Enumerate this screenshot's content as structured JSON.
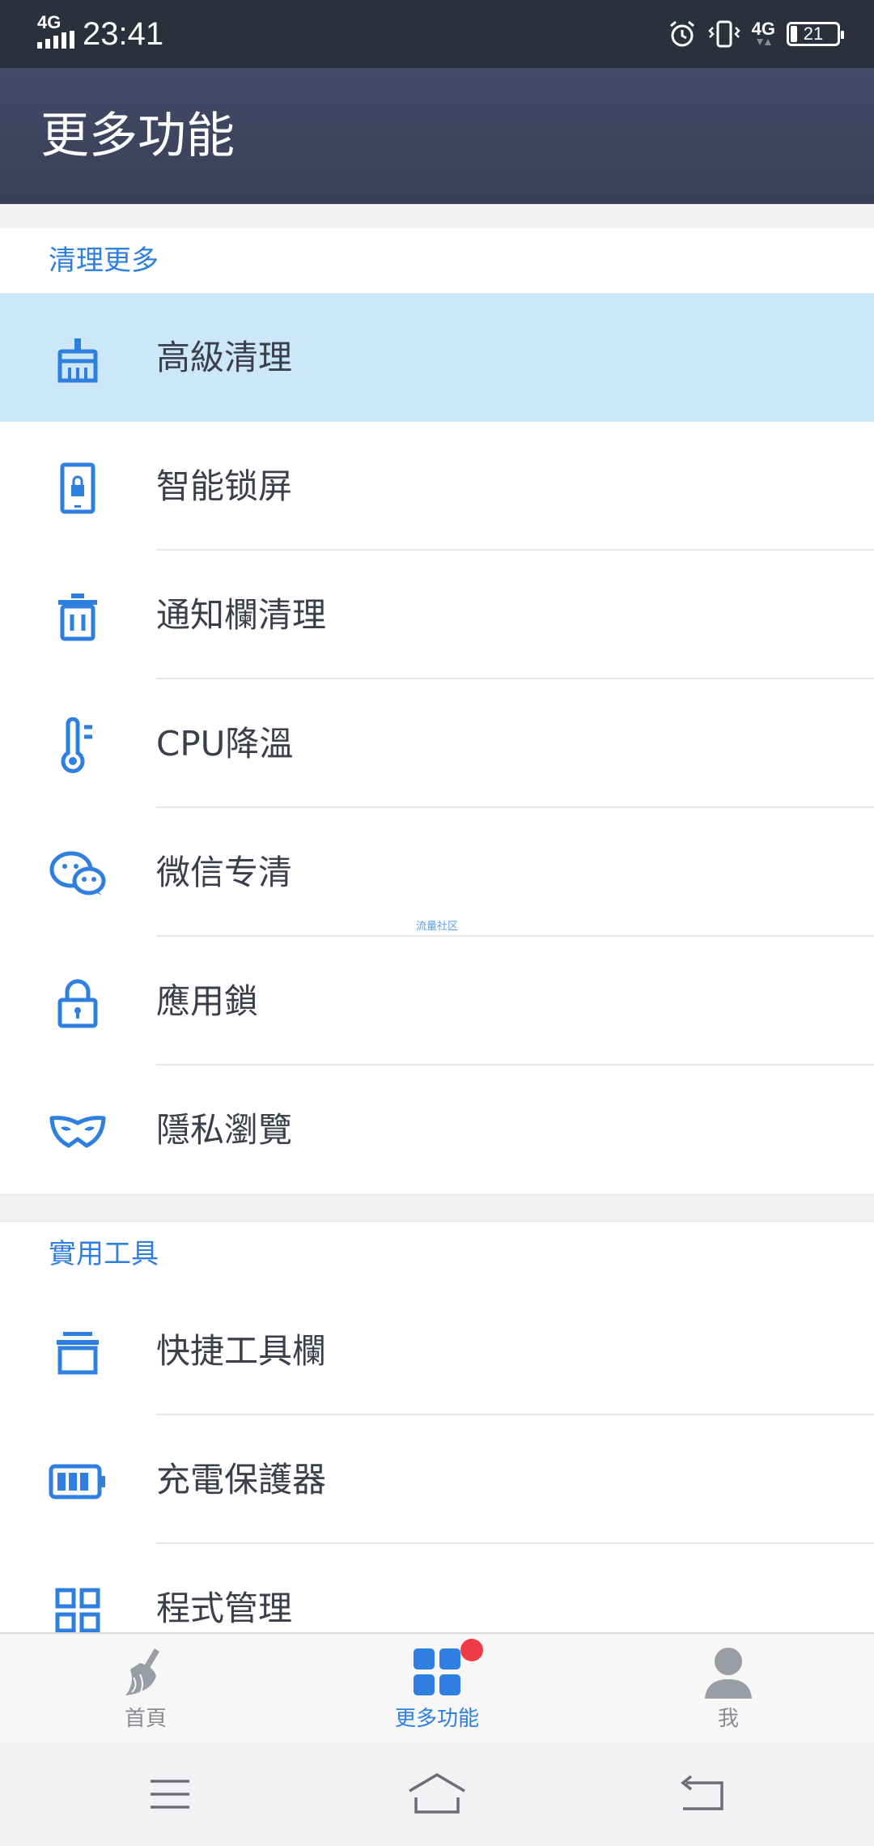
{
  "status_bar": {
    "network_left": "4G",
    "time": "23:41",
    "network_right": "4G",
    "battery": "21"
  },
  "header": {
    "title": "更多功能"
  },
  "sections": [
    {
      "title": "清理更多",
      "items": [
        {
          "label": "高級清理",
          "icon": "broom-icon"
        },
        {
          "label": "智能锁屏",
          "icon": "phone-lock-icon"
        },
        {
          "label": "通知欄清理",
          "icon": "trash-icon"
        },
        {
          "label": "CPU降溫",
          "icon": "thermometer-icon"
        },
        {
          "label": "微信专清",
          "icon": "wechat-icon"
        },
        {
          "label": "應用鎖",
          "icon": "padlock-icon"
        },
        {
          "label": "隱私瀏覽",
          "icon": "mask-icon"
        }
      ]
    },
    {
      "title": "實用工具",
      "items": [
        {
          "label": "快捷工具欄",
          "icon": "toolbox-icon"
        },
        {
          "label": "充電保護器",
          "icon": "battery-icon"
        },
        {
          "label": "程式管理",
          "icon": "grid-icon"
        }
      ]
    }
  ],
  "watermark": "流量社区",
  "bottom_nav": [
    {
      "label": "首頁",
      "icon": "broom-icon",
      "active": false
    },
    {
      "label": "更多功能",
      "icon": "apps-grid-icon",
      "active": true
    },
    {
      "label": "我",
      "icon": "person-icon",
      "active": false
    }
  ],
  "colors": {
    "accent": "#2f7fe0",
    "header": "#3f4560",
    "status_bar": "#2c2f3c",
    "active_row": "#cce7f8",
    "badge": "#ef3b47"
  }
}
